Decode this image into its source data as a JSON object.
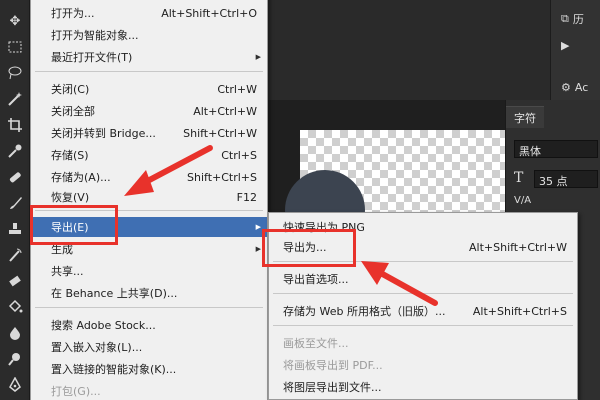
{
  "main_menu": {
    "items": [
      {
        "label": "打开为...",
        "shortcut": "Alt+Shift+Ctrl+O"
      },
      {
        "label": "打开为智能对象...",
        "shortcut": ""
      },
      {
        "label": "最近打开文件(T)",
        "shortcut": ""
      },
      {
        "label": "关闭(C)",
        "shortcut": "Ctrl+W"
      },
      {
        "label": "关闭全部",
        "shortcut": "Alt+Ctrl+W"
      },
      {
        "label": "关闭并转到 Bridge...",
        "shortcut": "Shift+Ctrl+W"
      },
      {
        "label": "存储(S)",
        "shortcut": "Ctrl+S"
      },
      {
        "label": "存储为(A)...",
        "shortcut": "Shift+Ctrl+S"
      },
      {
        "label": "恢复(V)",
        "shortcut": "F12"
      },
      {
        "label": "导出(E)",
        "shortcut": ""
      },
      {
        "label": "生成",
        "shortcut": ""
      },
      {
        "label": "共享...",
        "shortcut": ""
      },
      {
        "label": "在 Behance 上共享(D)...",
        "shortcut": ""
      },
      {
        "label": "搜索 Adobe Stock...",
        "shortcut": ""
      },
      {
        "label": "置入嵌入对象(L)...",
        "shortcut": ""
      },
      {
        "label": "置入链接的智能对象(K)...",
        "shortcut": ""
      },
      {
        "label": "打包(G)...",
        "shortcut": ""
      }
    ]
  },
  "export_submenu": {
    "items": [
      {
        "label": "快速导出为 PNG",
        "shortcut": ""
      },
      {
        "label": "导出为...",
        "shortcut": "Alt+Shift+Ctrl+W"
      },
      {
        "label": "导出首选项...",
        "shortcut": ""
      },
      {
        "label": "存储为 Web 所用格式（旧版）...",
        "shortcut": "Alt+Shift+Ctrl+S"
      },
      {
        "label": "画板至文件...",
        "shortcut": ""
      },
      {
        "label": "将画板导出到 PDF...",
        "shortcut": ""
      },
      {
        "label": "将图层导出到文件...",
        "shortcut": ""
      }
    ]
  },
  "character_panel": {
    "tab": "字符",
    "font": "黑体",
    "size_icon": "T",
    "size": "35 点",
    "va_label": "V/A"
  },
  "right_panel": {
    "history_label": "历",
    "actions_label": "Ac"
  },
  "colors": {
    "highlight": "#3f6fb3",
    "annotation_red": "#e8322b"
  }
}
